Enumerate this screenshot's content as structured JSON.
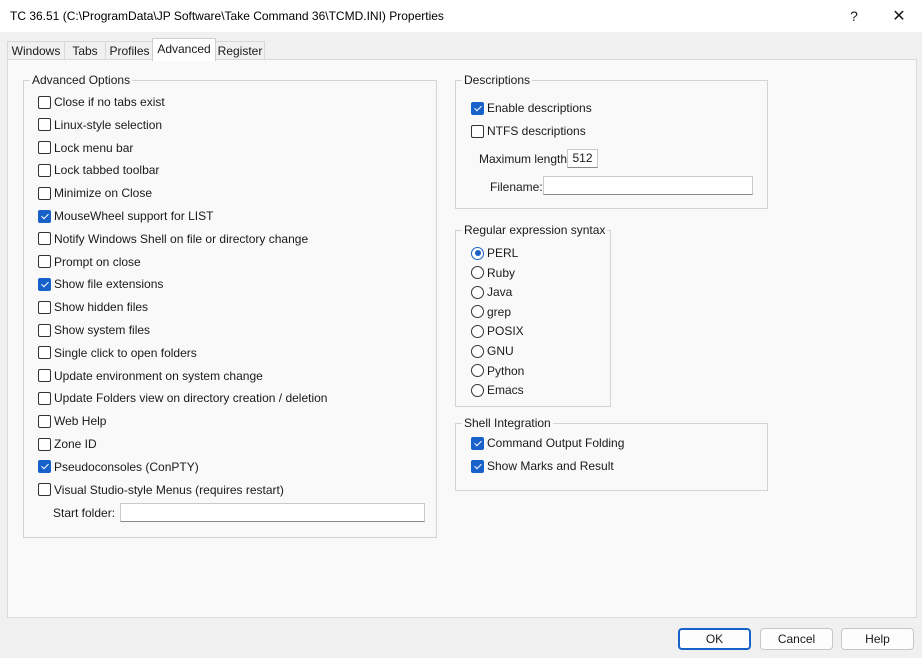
{
  "window": {
    "title": "TC 36.51  (C:\\ProgramData\\JP Software\\Take Command 36\\TCMD.INI)  Properties",
    "help_icon": "?",
    "close_icon": "✕"
  },
  "tabs": [
    {
      "label": "Windows",
      "active": false
    },
    {
      "label": "Tabs",
      "active": false
    },
    {
      "label": "Profiles",
      "active": false
    },
    {
      "label": "Advanced",
      "active": true
    },
    {
      "label": "Register",
      "active": false
    }
  ],
  "advanced_options": {
    "title": "Advanced Options",
    "items": [
      {
        "label": "Close if no tabs exist",
        "checked": false
      },
      {
        "label": "Linux-style selection",
        "checked": false
      },
      {
        "label": "Lock menu bar",
        "checked": false
      },
      {
        "label": "Lock tabbed toolbar",
        "checked": false
      },
      {
        "label": "Minimize on Close",
        "checked": false
      },
      {
        "label": "MouseWheel support for LIST",
        "checked": true
      },
      {
        "label": "Notify Windows Shell on file or directory change",
        "checked": false
      },
      {
        "label": "Prompt on close",
        "checked": false
      },
      {
        "label": "Show file extensions",
        "checked": true
      },
      {
        "label": "Show hidden files",
        "checked": false
      },
      {
        "label": "Show system files",
        "checked": false
      },
      {
        "label": "Single click to open folders",
        "checked": false
      },
      {
        "label": "Update environment on system change",
        "checked": false
      },
      {
        "label": "Update Folders view on directory creation / deletion",
        "checked": false
      },
      {
        "label": "Web Help",
        "checked": false
      },
      {
        "label": "Zone ID",
        "checked": false
      },
      {
        "label": "Pseudoconsoles (ConPTY)",
        "checked": true
      },
      {
        "label": "Visual Studio-style Menus (requires restart)",
        "checked": false
      }
    ],
    "start_folder_label": "Start folder:",
    "start_folder_value": ""
  },
  "descriptions": {
    "title": "Descriptions",
    "enable_label": "Enable descriptions",
    "enable_checked": true,
    "ntfs_label": "NTFS descriptions",
    "ntfs_checked": false,
    "max_length_label": "Maximum length:",
    "max_length_value": "512",
    "filename_label": "Filename:",
    "filename_value": ""
  },
  "regex": {
    "title": "Regular expression syntax",
    "options": [
      {
        "label": "PERL",
        "selected": true
      },
      {
        "label": "Ruby",
        "selected": false
      },
      {
        "label": "Java",
        "selected": false
      },
      {
        "label": "grep",
        "selected": false
      },
      {
        "label": "POSIX",
        "selected": false
      },
      {
        "label": "GNU",
        "selected": false
      },
      {
        "label": "Python",
        "selected": false
      },
      {
        "label": "Emacs",
        "selected": false
      }
    ]
  },
  "shell_integration": {
    "title": "Shell Integration",
    "items": [
      {
        "label": "Command Output Folding",
        "checked": true
      },
      {
        "label": "Show Marks and Result",
        "checked": true
      }
    ]
  },
  "buttons": {
    "ok": "OK",
    "cancel": "Cancel",
    "help": "Help"
  },
  "colors": {
    "accent": "#1761c9",
    "window_bg": "#f0f0f0",
    "panel_bg": "#f9f9f9"
  }
}
